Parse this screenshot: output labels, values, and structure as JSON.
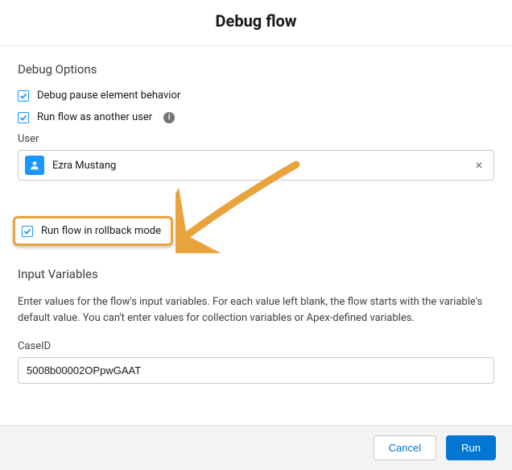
{
  "title": "Debug flow",
  "debugOptions": {
    "heading": "Debug Options",
    "items": [
      {
        "label": "Debug pause element behavior",
        "checked": true
      },
      {
        "label": "Run flow as another user",
        "checked": true,
        "info": true
      }
    ],
    "userLabel": "User",
    "userValue": "Ezra Mustang",
    "rollback": {
      "label": "Run flow in rollback mode",
      "checked": true
    }
  },
  "inputVars": {
    "heading": "Input Variables",
    "description": "Enter values for the flow's input variables. For each value left blank, the flow starts with the variable's default value. You can't enter values for collection variables or Apex-defined variables.",
    "fields": [
      {
        "label": "CaseID",
        "value": "5008b00002OPpwGAAT"
      }
    ]
  },
  "footer": {
    "cancel": "Cancel",
    "run": "Run"
  },
  "annotation": {
    "arrowColor": "#e8a33d"
  }
}
